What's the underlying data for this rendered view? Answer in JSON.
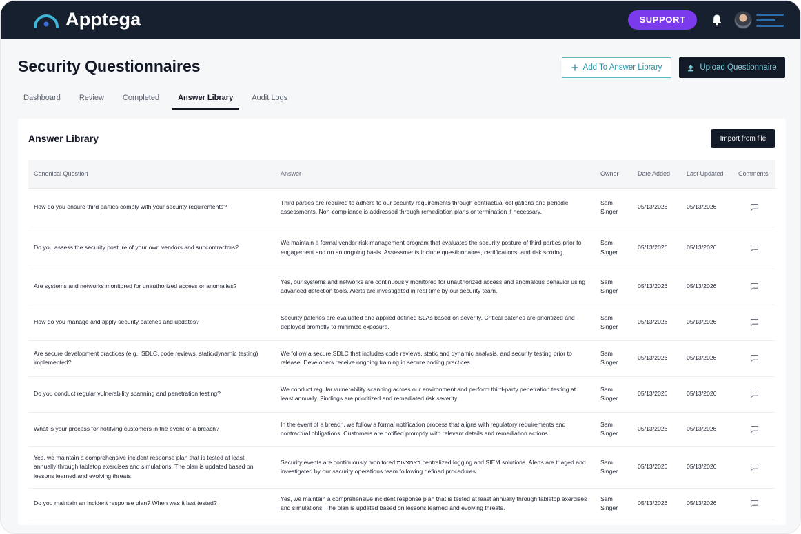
{
  "app": {
    "logo_text": "Apptega",
    "support_label": "SUPPORT"
  },
  "page": {
    "title": "Security Questionnaires",
    "add_to_library_label": "Add To Answer Library",
    "upload_label": "Upload Questionnaire"
  },
  "tabs": [
    {
      "label": "Dashboard",
      "active": false
    },
    {
      "label": "Review",
      "active": false
    },
    {
      "label": "Completed",
      "active": false
    },
    {
      "label": "Answer Library",
      "active": true
    },
    {
      "label": "Audit Logs",
      "active": false
    }
  ],
  "library": {
    "title": "Answer Library",
    "import_label": "Import from file",
    "columns": [
      "Canonical Question",
      "Answer",
      "Owner",
      "Date Added",
      "Last Updated",
      "Comments"
    ],
    "rows": [
      {
        "question": "How do you ensure third parties comply with your security requirements?",
        "answer": "Third parties are required to adhere to our security requirements through contractual obligations and periodic assessments. Non-compliance is addressed through remediation plans or termination if necessary.",
        "owner": "Sam Singer",
        "date_added": "05/13/2026",
        "last_updated": "05/13/2026"
      },
      {
        "question": "Do you assess the security posture of your own vendors and subcontractors?",
        "answer": "We maintain a formal vendor risk management program that evaluates the security posture of third parties prior to engagement and on an ongoing basis. Assessments include questionnaires, certifications, and risk scoring.",
        "owner": "Sam Singer",
        "date_added": "05/13/2026",
        "last_updated": "05/13/2026"
      },
      {
        "question": "Are systems and networks monitored for unauthorized access or anomalies?",
        "answer": "Yes, our systems and networks are continuously monitored for unauthorized access and anomalous behavior using advanced detection tools. Alerts are investigated in real time by our security team.",
        "owner": "Sam Singer",
        "date_added": "05/13/2026",
        "last_updated": "05/13/2026"
      },
      {
        "question": "How do you manage and apply security patches and updates?",
        "answer": "Security patches are evaluated and applied defined SLAs based on severity. Critical patches are prioritized and deployed promptly to minimize exposure.",
        "owner": "Sam Singer",
        "date_added": "05/13/2026",
        "last_updated": "05/13/2026"
      },
      {
        "question": "Are secure development practices (e.g., SDLC, code reviews, static/dynamic testing) implemented?",
        "answer": "We follow a secure SDLC that includes code reviews, static and dynamic analysis, and security testing prior to release. Developers receive ongoing training in secure coding practices.",
        "owner": "Sam Singer",
        "date_added": "05/13/2026",
        "last_updated": "05/13/2026"
      },
      {
        "question": "Do you conduct regular vulnerability scanning and penetration testing?",
        "answer": "We conduct regular vulnerability scanning across our environment and perform third-party penetration testing at least annually. Findings are prioritized and remediated risk severity.",
        "owner": "Sam Singer",
        "date_added": "05/13/2026",
        "last_updated": "05/13/2026"
      },
      {
        "question": "What is your process for notifying customers in the event of a breach?",
        "answer": "In the event of a breach, we follow a formal notification process that aligns with regulatory requirements and contractual obligations. Customers are notified promptly with relevant details and remediation actions.",
        "owner": "Sam Singer",
        "date_added": "05/13/2026",
        "last_updated": "05/13/2026"
      },
      {
        "question": "Yes, we maintain a comprehensive incident response plan that is tested at least annually through tabletop exercises and simulations. The plan is updated based on lessons learned and evolving threats.",
        "answer": "Security events are continuously monitored באמצעות centralized logging and SIEM solutions. Alerts are triaged and investigated by our security operations team following defined procedures.",
        "owner": "Sam Singer",
        "date_added": "05/13/2026",
        "last_updated": "05/13/2026"
      },
      {
        "question": "Do you maintain an incident response plan? When was it last tested?",
        "answer": "Yes, we maintain a comprehensive incident response plan that is tested at least annually through tabletop exercises and simulations. The plan is updated based on lessons learned and evolving threats.",
        "owner": "Sam Singer",
        "date_added": "05/13/2026",
        "last_updated": "05/13/2026"
      }
    ]
  },
  "icons": {
    "logo": "apptega-logo-icon",
    "bell": "bell-icon",
    "menu": "menu-icon",
    "plus": "plus-icon",
    "upload": "upload-icon",
    "comment": "comment-icon"
  },
  "colors": {
    "topbar": "#17202e",
    "support": "#7c3aed",
    "accent_teal": "#2a8fa0",
    "dark_button": "#121a27"
  }
}
